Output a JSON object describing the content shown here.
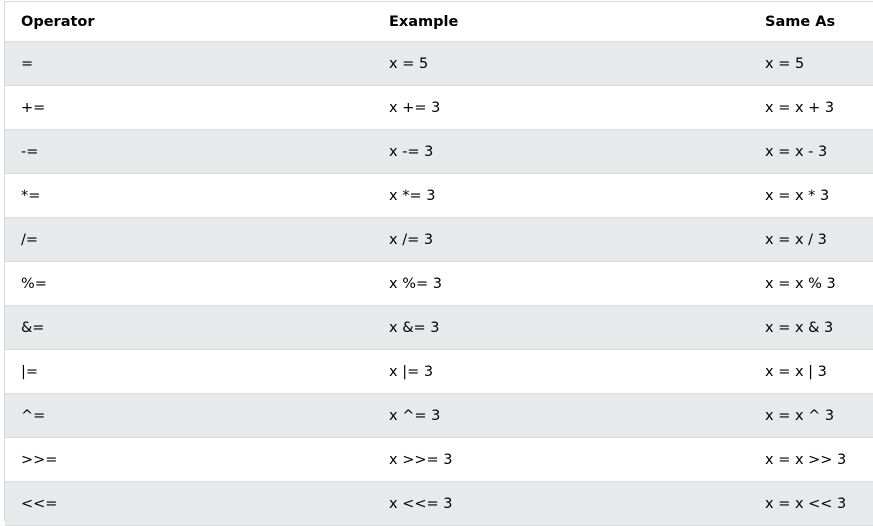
{
  "table": {
    "headers": [
      "Operator",
      "Example",
      "Same As"
    ],
    "rows": [
      [
        "=",
        "x = 5",
        "x = 5"
      ],
      [
        "+=",
        "x += 3",
        "x = x + 3"
      ],
      [
        "-=",
        "x -= 3",
        "x = x - 3"
      ],
      [
        "*=",
        "x *= 3",
        "x = x * 3"
      ],
      [
        "/=",
        "x /= 3",
        "x = x / 3"
      ],
      [
        "%=",
        "x %= 3",
        "x = x % 3"
      ],
      [
        "&=",
        "x &= 3",
        "x = x & 3"
      ],
      [
        "|=",
        "x |= 3",
        "x = x | 3"
      ],
      [
        "^=",
        "x ^= 3",
        "x = x ^ 3"
      ],
      [
        ">>=",
        "x >>= 3",
        "x = x >> 3"
      ],
      [
        "<<=",
        "x <<= 3",
        "x = x << 3"
      ]
    ]
  },
  "colors": {
    "header_bg": "#ffffff",
    "stripe_bg": "#e7e9eb",
    "row_bg": "#ffffff",
    "border": "#dddddd",
    "text": "#000000"
  }
}
